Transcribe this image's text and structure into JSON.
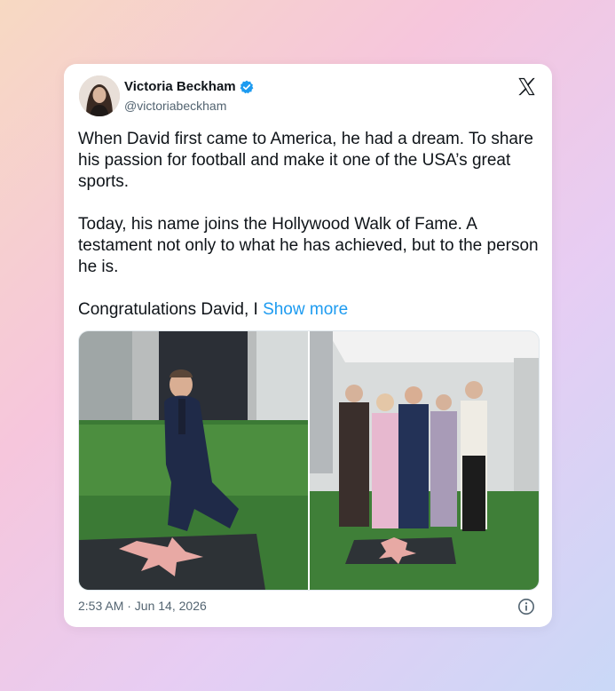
{
  "author": {
    "display_name": "Victoria Beckham",
    "handle": "@victoriabeckham",
    "verified": true,
    "verified_color": "#1d9bf0"
  },
  "tweet": {
    "paragraphs": [
      "When David first came to America, he had a dream. To share his passion for football and make it one of the USA’s great sports.",
      "Today, his name joins the Hollywood Walk of Fame. A testament not only to what he has achieved, but to the person he is."
    ],
    "last_line": "Congratulations David, I",
    "show_more": "Show more",
    "link_color": "#1d9bf0"
  },
  "media": {
    "photos": [
      {
        "icon": "walk-of-fame-kneeling-photo"
      },
      {
        "icon": "walk-of-fame-family-photo"
      }
    ]
  },
  "footer": {
    "timestamp": "2:53 AM · Jun 14, 2026"
  },
  "icons": {
    "brand": "x-logo-icon",
    "info": "info-icon"
  }
}
